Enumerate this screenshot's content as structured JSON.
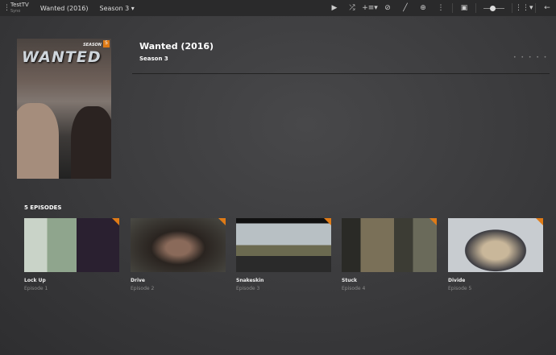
{
  "topbar": {
    "server": "TestTV",
    "server_sub": "Syno",
    "breadcrumb_show": "Wanted (2016)",
    "breadcrumb_season": "Season 3 ▾",
    "icons": [
      "play-icon",
      "shuffle-icon",
      "add-to-queue-icon",
      "mark-watched-icon",
      "edit-icon",
      "download-icon",
      "more-icon",
      "poster-view-icon",
      "size-slider",
      "grid-view-icon",
      "back-icon"
    ]
  },
  "poster": {
    "logo": "WANTED",
    "season_label": "SEASON",
    "season_number": "5"
  },
  "header": {
    "title": "Wanted (2016)",
    "subtitle": "Season 3",
    "rating": "• • • • •"
  },
  "episodes": {
    "heading": "5 EPISODES",
    "accent": "#e07b16",
    "items": [
      {
        "title": "Lock Up",
        "number": "Episode 1"
      },
      {
        "title": "Drive",
        "number": "Episode 2"
      },
      {
        "title": "Snakeskin",
        "number": "Episode 3"
      },
      {
        "title": "Stuck",
        "number": "Episode 4"
      },
      {
        "title": "Divide",
        "number": "Episode 5"
      }
    ]
  }
}
